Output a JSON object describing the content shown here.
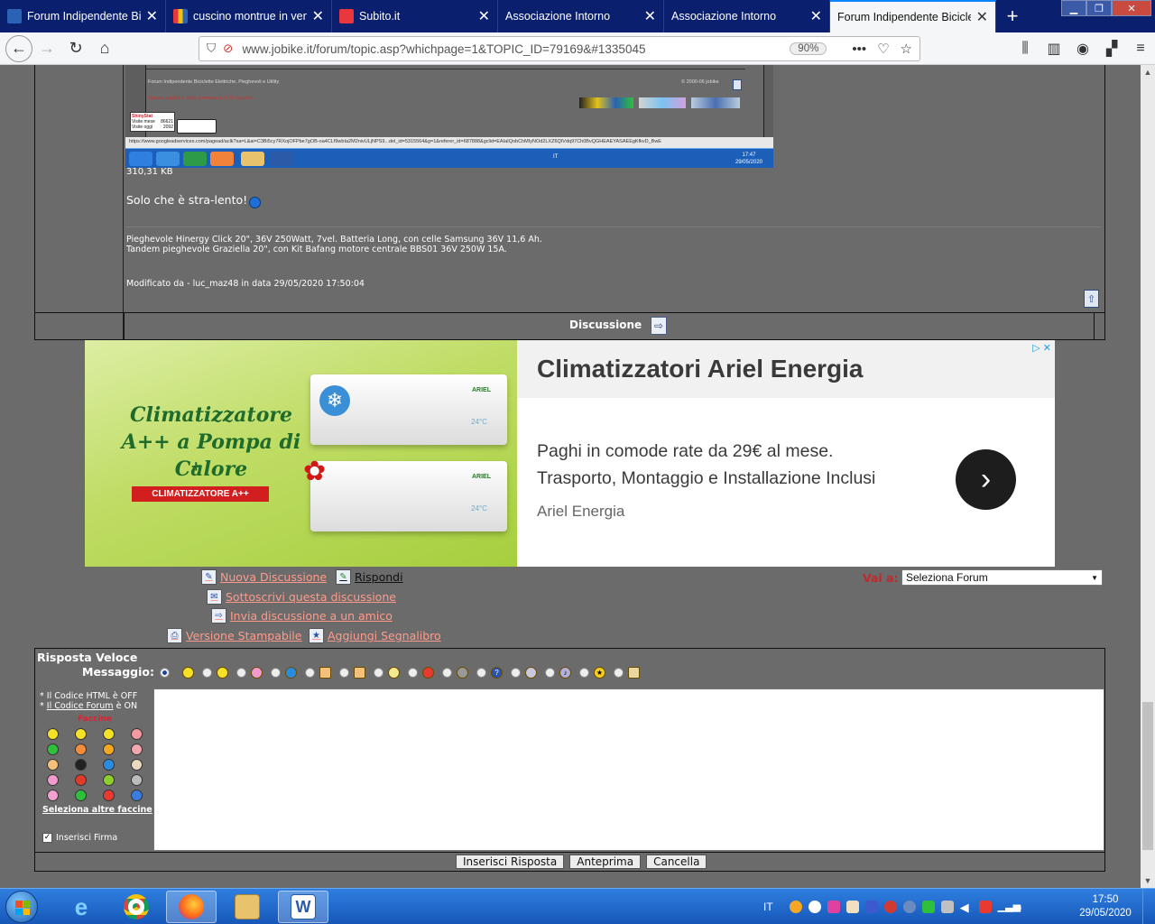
{
  "browser": {
    "tabs": [
      {
        "title": "Forum Indipendente Biciclette",
        "favicon_color": "#2a62b4",
        "active": false
      },
      {
        "title": "cuscino montrue in vendita",
        "favicon_color": "#f2c014",
        "active": false
      },
      {
        "title": "Subito.it",
        "favicon_color": "#e8383d",
        "active": false
      },
      {
        "title": "Associazione Intorno",
        "favicon_color": "#0a1f6e",
        "active": false
      },
      {
        "title": "Associazione Intorno",
        "favicon_color": "#0a1f6e",
        "active": false
      },
      {
        "title": "Forum Indipendente Biciclette",
        "favicon_color": "#2a62b4",
        "active": true
      }
    ],
    "url": "www.jobike.it/forum/topic.asp?whichpage=1&TOPIC_ID=79169&#1335045",
    "zoom": "90%"
  },
  "attachment": {
    "footer_site": "Forum Indipendente Biciclette Elettriche, Pieghevoli e Utility",
    "copyright": "© 2000-06 jobike",
    "gen_time": "Questa pagina è stata generata in 0,35 secondi.",
    "status_url": "https://www.googleadservices.com/pagead/aclk?sa=L&ai=C3Bi5cy7RXojOFPbe7gOB-oa4CLf9wbIa2M2nivULjNPS9...del_id=5315564&g=1&referer_id=687888&gclid=EAIaIQobChMIyNOd2LXZ6QIVdq97Ch0BvQGHEAEYASAEEgKfkvD_BwE",
    "clock_time": "17:47",
    "clock_date": "29/05/2020",
    "lang": "IT",
    "counter_title": "ShinyStat",
    "counter_mese_label": "Visite mese",
    "counter_mese": "86621",
    "counter_oggi_label": "Visite oggi",
    "counter_oggi": "2092"
  },
  "post": {
    "size": "310,31 KB",
    "message": "Solo che è stra-lento!",
    "signature_line1": "Pieghevole Hinergy Click 20\", 36V 250Watt, 7vel. Batteria Long, con celle Samsung 36V 11,6 Ah.",
    "signature_line2": "Tandem pieghevole Graziella 20\", con Kit Bafang motore centrale BBS01 36V 250W 15A.",
    "modified": "Modificato da - luc_maz48 in data 29/05/2020 17:50:04",
    "discussion_label": "Discussione"
  },
  "ad": {
    "image_headline": "Climatizzatore A++ a Pompa di Calore",
    "image_plus": "+",
    "image_badge": "CLIMATIZZATORE A++",
    "unit_brand": "ARIEL",
    "unit_temp": "24°C",
    "title": "Climatizzatori Ariel Energia",
    "line1": "Paghi in comode rate da 29€ al mese.",
    "line2": "Trasporto, Montaggio e Installazione Inclusi",
    "advertiser": "Ariel Energia"
  },
  "actions": {
    "new_topic": "Nuova Discussione",
    "reply": "Rispondi",
    "subscribe": "Sottoscrivi questa discussione",
    "send_friend": "Invia discussione a un amico",
    "print": "Versione Stampabile",
    "bookmark": "Aggiungi Segnalibro",
    "goto_label": "Vai a:",
    "goto_value": "Seleziona Forum"
  },
  "quick_reply": {
    "title": "Risposta Veloce",
    "message_label": "Messaggio:",
    "html_note": "Il Codice HTML è OFF",
    "html_prefix": "* ",
    "forum_code_link": "Il Codice Forum",
    "forum_code_suffix": " è ON",
    "faccine_label": "Faccine",
    "more_faces": "Seleziona altre faccine",
    "signature_label": "Inserisci Firma",
    "submit": "Inserisci Risposta",
    "preview": "Anteprima",
    "cancel": "Cancella",
    "smileys": [
      "none",
      "smile",
      "big-smile",
      "wink",
      "sad",
      "thumbs-down",
      "thumbs-up",
      "idea",
      "heart",
      "eight-ball",
      "question",
      "moon",
      "music",
      "star",
      "cake"
    ],
    "face_colors": [
      "#f5e227",
      "#f5e227",
      "#f5e227",
      "#f19aa0",
      "#2fbf3b",
      "#f28d3d",
      "#f5a623",
      "#f2a7b0",
      "#f5c07a",
      "#222222",
      "#2a8ce0",
      "#e9d9c0",
      "#f29ad0",
      "#e03a2a",
      "#8ccf2a",
      "#bcbcbc",
      "#f2a0d0",
      "#2fbf3b",
      "#e83a30",
      "#3b7ce0"
    ]
  },
  "taskbar": {
    "apps": [
      "internet-explorer",
      "chrome",
      "firefox",
      "explorer",
      "word"
    ],
    "lang": "IT",
    "time": "17:50",
    "date": "29/05/2020"
  }
}
